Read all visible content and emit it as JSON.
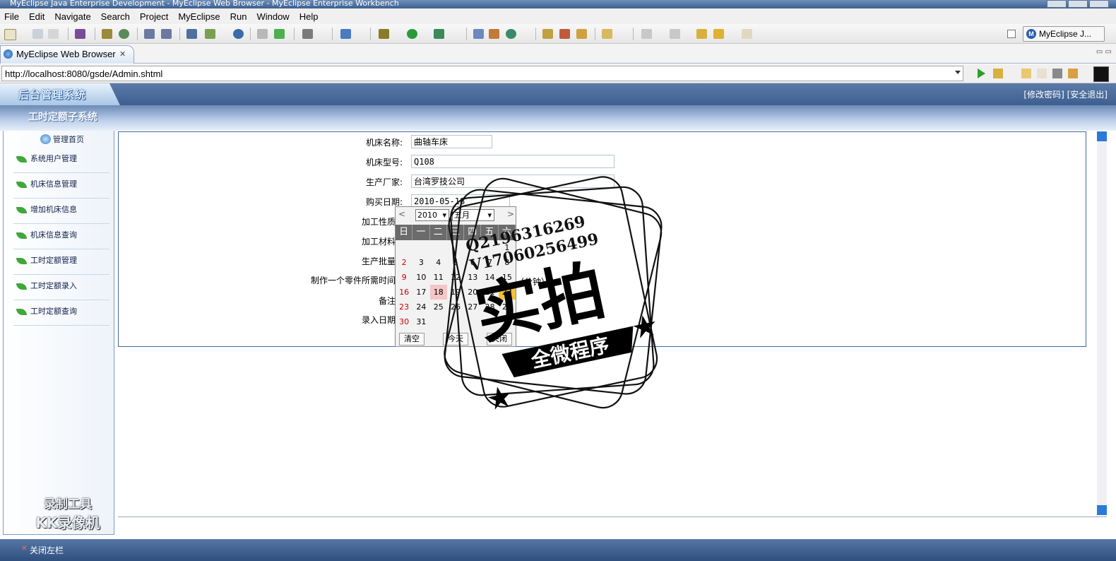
{
  "window": {
    "title": "MyEclipse Java Enterprise Development - MyEclipse Web Browser - MyEclipse Enterprise Workbench"
  },
  "menu": [
    "File",
    "Edit",
    "Navigate",
    "Search",
    "Project",
    "MyEclipse",
    "Run",
    "Window",
    "Help"
  ],
  "toolbar": {
    "perspective_label": "MyEclipse J..."
  },
  "editor_tab": {
    "label": "MyEclipse Web Browser",
    "close": "✕"
  },
  "browser": {
    "url": "http://localhost:8080/gsde/Admin.shtml"
  },
  "site": {
    "logo_text": "后台管理系统",
    "header_links": {
      "change_password": "[修改密码]",
      "logout": "[安全退出]"
    },
    "subheader_title": "工时定额子系统"
  },
  "sidebar": {
    "home_label": "管理首页",
    "items": [
      "系统用户管理",
      "机床信息管理",
      "增加机床信息",
      "机床信息查询",
      "工时定额管理",
      "工时定额录入",
      "工时定额查询"
    ],
    "watermark_line1": "录制工具",
    "watermark_line2": "KK录像机"
  },
  "form": {
    "machine_name": {
      "label": "机床名称:",
      "value": "曲轴车床"
    },
    "machine_model": {
      "label": "机床型号:",
      "value": "Q108"
    },
    "manufacturer": {
      "label": "生产厂家:",
      "value": "台湾罗技公司"
    },
    "purchase_date": {
      "label": "购买日期:",
      "value": "2010-05-18"
    },
    "processing_nature": {
      "label": "加工性质"
    },
    "processing_material": {
      "label": "加工材料"
    },
    "production_batch": {
      "label": "生产批量"
    },
    "time_per_part": {
      "label": "制作一个零件所需时间",
      "unit": "（分钟）"
    },
    "remarks": {
      "label": "备注"
    },
    "entry_date": {
      "label": "录入日期"
    }
  },
  "calendar": {
    "prev": "<",
    "next": ">",
    "year": "2010",
    "month": "五月",
    "weekdays": [
      "日",
      "一",
      "二",
      "三",
      "四",
      "五",
      "六"
    ],
    "rows": [
      [
        "",
        "",
        "",
        "",
        "",
        "",
        "1"
      ],
      [
        "2",
        "3",
        "4",
        "5",
        "6",
        "7",
        "8"
      ],
      [
        "9",
        "10",
        "11",
        "12",
        "13",
        "14",
        "15"
      ],
      [
        "16",
        "17",
        "18",
        "19",
        "20",
        "21",
        "22"
      ],
      [
        "23",
        "24",
        "25",
        "26",
        "27",
        "28",
        "29"
      ],
      [
        "30",
        "31",
        "",
        "",
        "",
        "",
        ""
      ]
    ],
    "today": "18",
    "selected": "22",
    "buttons": {
      "clear": "清空",
      "today": "今天",
      "close": "关闭"
    }
  },
  "stamp": {
    "qq": "Q2196316269",
    "wechat": "V17060256499",
    "main": "实拍",
    "banner": "全微程序"
  },
  "status": {
    "close_left": "关闭左栏"
  }
}
